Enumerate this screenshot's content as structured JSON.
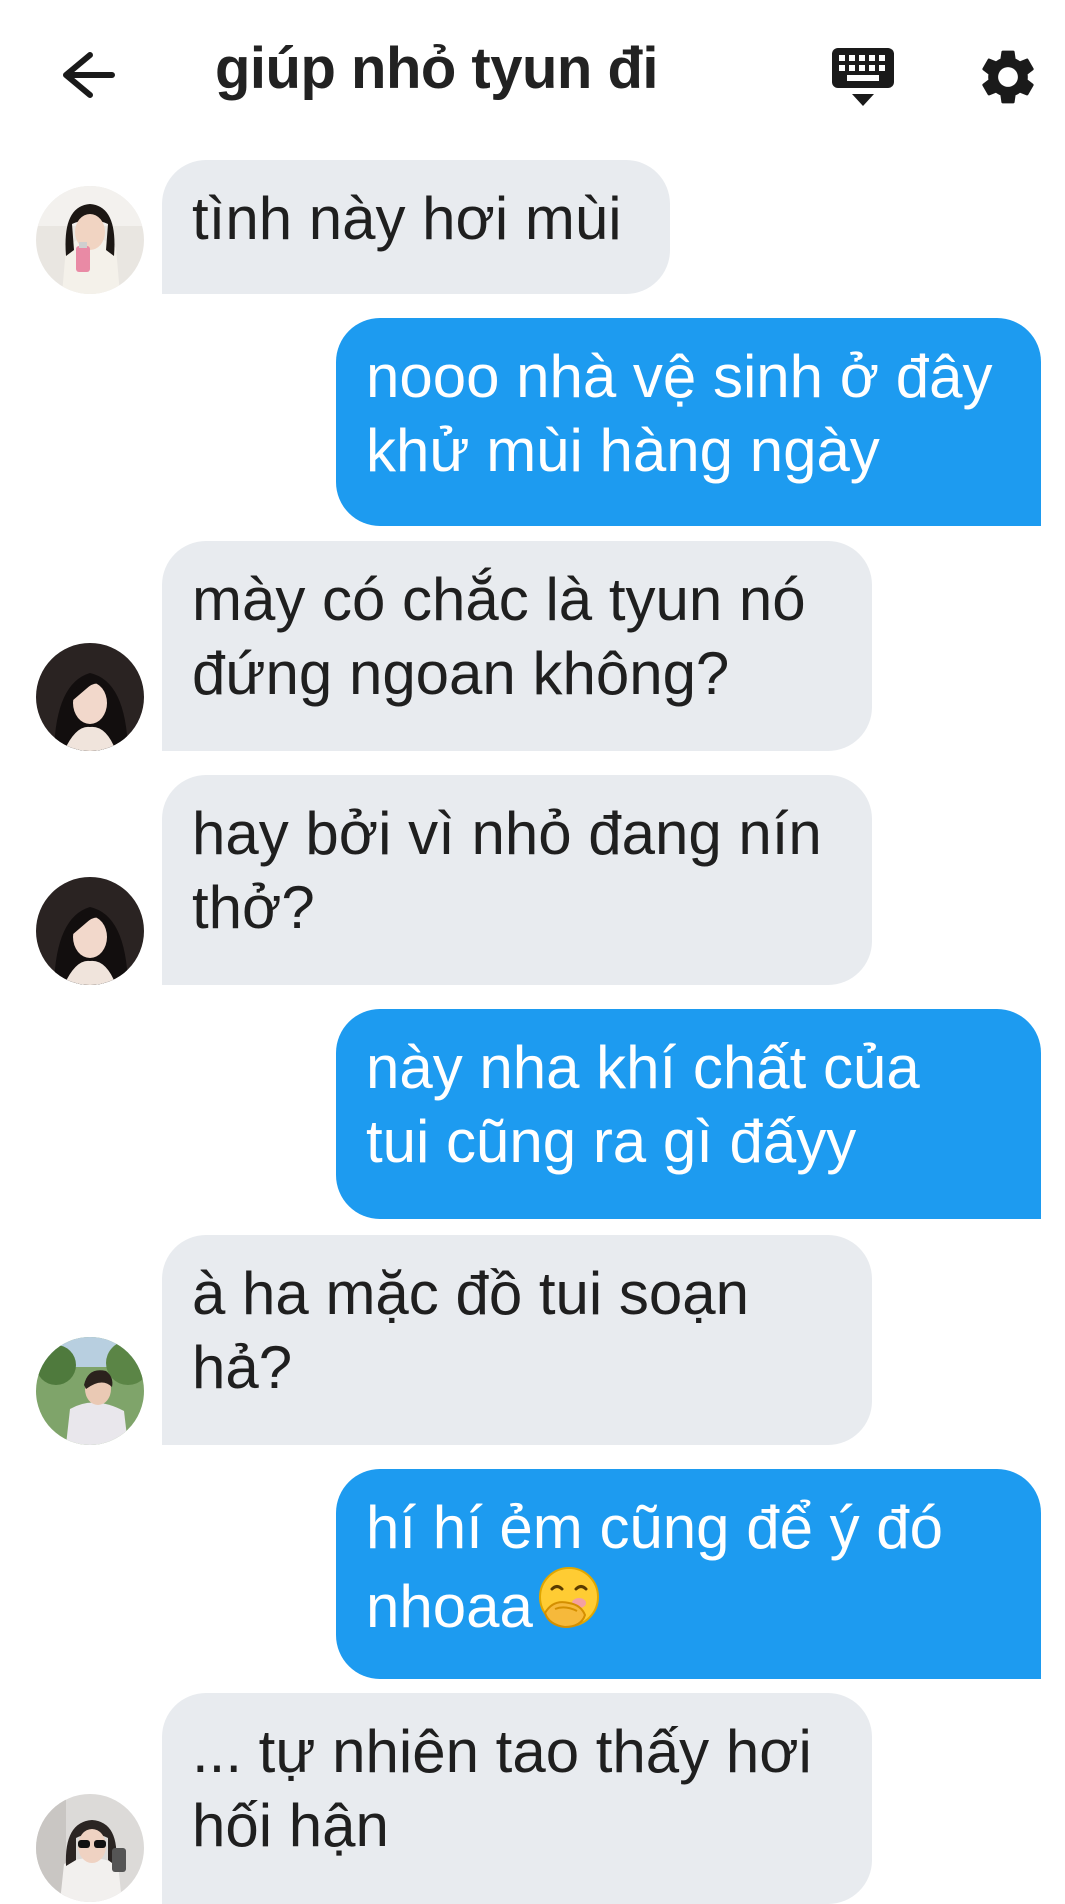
{
  "header": {
    "title": "giúp nhỏ tyun đi",
    "back_icon": "arrow-left-icon",
    "keyboard_icon": "keyboard-icon",
    "settings_icon": "gear-icon"
  },
  "colors": {
    "incoming_bubble": "#e8ebef",
    "outgoing_bubble": "#1d9bf0",
    "title_text": "#222222"
  },
  "messages": [
    {
      "side": "incoming",
      "avatar": "avatar-girl-pink-cup",
      "lines": [
        "tình này hơi mùi"
      ]
    },
    {
      "side": "outgoing",
      "lines": [
        "nooo nhà vệ sinh ở đây",
        "khử mùi hàng ngày"
      ]
    },
    {
      "side": "incoming",
      "avatar": "avatar-girl-dark-hair",
      "lines": [
        "mày có chắc là tyun nó",
        "đứng ngoan không?"
      ]
    },
    {
      "side": "incoming",
      "avatar": "avatar-girl-dark-hair",
      "lines": [
        "hay bởi vì nhỏ đang nín",
        "thở?"
      ]
    },
    {
      "side": "outgoing",
      "lines": [
        "này nha khí chất của",
        "tui cũng ra gì đấyy"
      ]
    },
    {
      "side": "incoming",
      "avatar": "avatar-boy-outdoor",
      "lines": [
        "à ha mặc đồ tui soạn",
        "hả?"
      ]
    },
    {
      "side": "outgoing",
      "lines": [
        "hí hí ẻm cũng để ý đó",
        "nhoaa"
      ],
      "emoji": "face-with-hand-over-mouth-icon"
    },
    {
      "side": "incoming",
      "avatar": "avatar-girl-sunglasses",
      "lines": [
        "... tự nhiên tao thấy hơi",
        "hối hận"
      ]
    }
  ]
}
